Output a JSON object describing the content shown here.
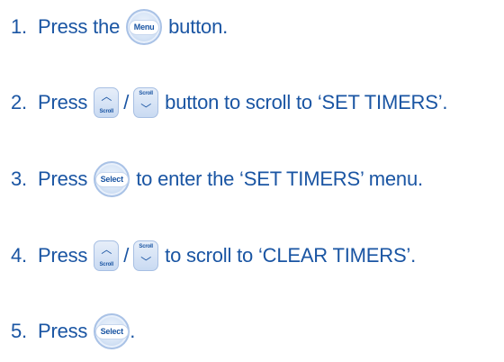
{
  "colors": {
    "text": "#1a55a3",
    "button_fill": "#d6e4f6",
    "button_border": "#a9c2e6"
  },
  "icons": {
    "up": "chevron-up-icon",
    "down": "chevron-down-icon"
  },
  "buttons": {
    "menu": "Menu",
    "select": "Select",
    "scroll": "Scroll",
    "slash": "/"
  },
  "steps": [
    {
      "num": "1.",
      "before": "Press the",
      "after": "button."
    },
    {
      "num": "2.",
      "before": "Press",
      "after": "button to scroll to ‘SET TIMERS’."
    },
    {
      "num": "3.",
      "before": "Press",
      "after": "to enter the ‘SET TIMERS’ menu."
    },
    {
      "num": "4.",
      "before": "Press",
      "after": "to scroll to ‘CLEAR TIMERS’."
    },
    {
      "num": "5.",
      "before": "Press",
      "after": "."
    }
  ]
}
